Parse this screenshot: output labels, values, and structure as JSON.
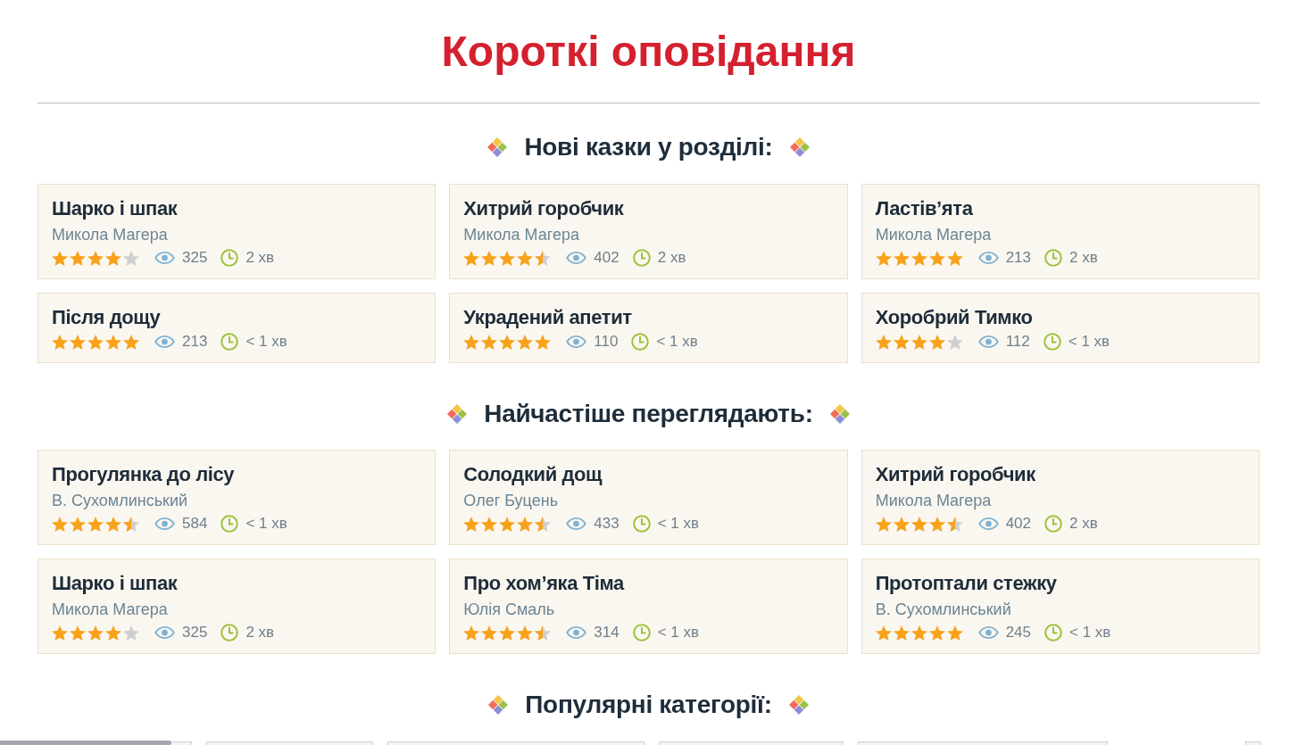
{
  "page_title": "Короткі оповідання",
  "sections": [
    {
      "heading": "Нові казки у розділі:",
      "stories": [
        {
          "title": "Шарко і шпак",
          "author": "Микола Магера",
          "stars": 4,
          "views": "325",
          "read_time": "2 хв"
        },
        {
          "title": "Хитрий горобчик",
          "author": "Микола Магера",
          "stars": 4.5,
          "views": "402",
          "read_time": "2 хв"
        },
        {
          "title": "Ластів’ята",
          "author": "Микола Магера",
          "stars": 5,
          "views": "213",
          "read_time": "2 хв"
        },
        {
          "title": "Після дощу",
          "stars": 5,
          "views": "213",
          "read_time": "< 1 хв"
        },
        {
          "title": "Украдений апетит",
          "stars": 5,
          "views": "110",
          "read_time": "< 1 хв"
        },
        {
          "title": "Хоробрий Тимко",
          "stars": 4,
          "views": "112",
          "read_time": "< 1 хв"
        }
      ]
    },
    {
      "heading": "Найчастіше переглядають:",
      "stories": [
        {
          "title": "Прогулянка до лісу",
          "author": "В. Сухомлинський",
          "stars": 4.5,
          "views": "584",
          "read_time": "< 1 хв"
        },
        {
          "title": "Солодкий дощ",
          "author": "Олег Буцень",
          "stars": 4.5,
          "views": "433",
          "read_time": "< 1 хв"
        },
        {
          "title": "Хитрий горобчик",
          "author": "Микола Магера",
          "stars": 4.5,
          "views": "402",
          "read_time": "2 хв"
        },
        {
          "title": "Шарко і шпак",
          "author": "Микола Магера",
          "stars": 4,
          "views": "325",
          "read_time": "2 хв"
        },
        {
          "title": "Про хом’яка Тіма",
          "author": "Юлія Смаль",
          "stars": 4.5,
          "views": "314",
          "read_time": "< 1 хв"
        },
        {
          "title": "Протоптали стежку",
          "author": "В. Сухомлинський",
          "stars": 5,
          "views": "245",
          "read_time": "< 1 хв"
        }
      ]
    }
  ],
  "popular_categories": {
    "heading": "Популярні категорії:"
  }
}
